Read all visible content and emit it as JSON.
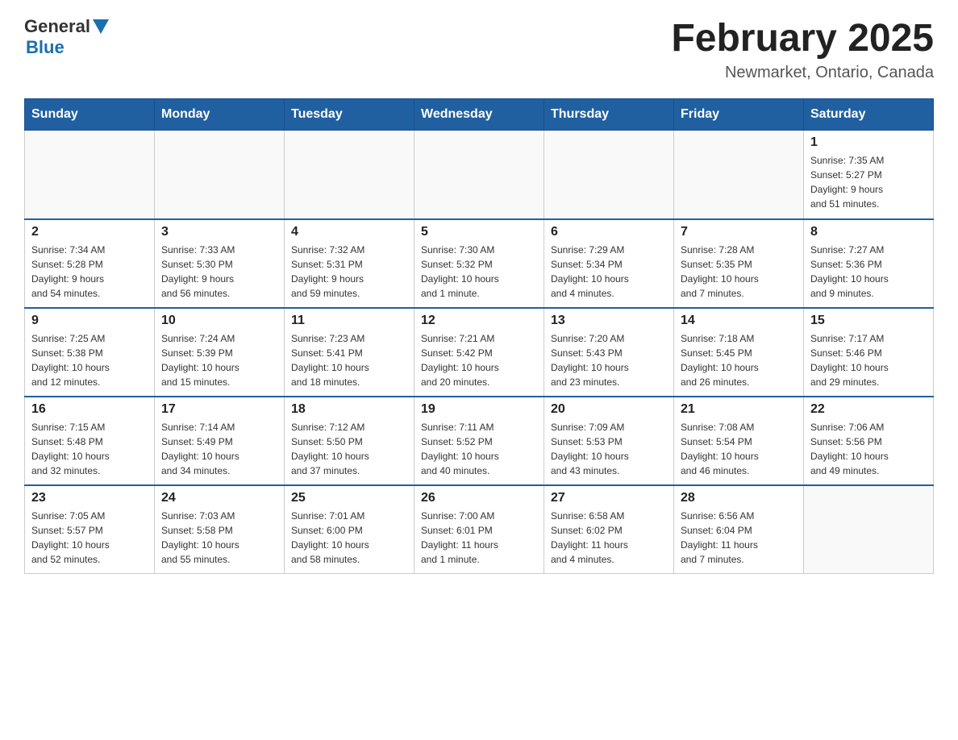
{
  "header": {
    "logo_general": "General",
    "logo_blue": "Blue",
    "month_title": "February 2025",
    "location": "Newmarket, Ontario, Canada"
  },
  "days_of_week": [
    "Sunday",
    "Monday",
    "Tuesday",
    "Wednesday",
    "Thursday",
    "Friday",
    "Saturday"
  ],
  "weeks": [
    [
      {
        "day": "",
        "info": ""
      },
      {
        "day": "",
        "info": ""
      },
      {
        "day": "",
        "info": ""
      },
      {
        "day": "",
        "info": ""
      },
      {
        "day": "",
        "info": ""
      },
      {
        "day": "",
        "info": ""
      },
      {
        "day": "1",
        "info": "Sunrise: 7:35 AM\nSunset: 5:27 PM\nDaylight: 9 hours\nand 51 minutes."
      }
    ],
    [
      {
        "day": "2",
        "info": "Sunrise: 7:34 AM\nSunset: 5:28 PM\nDaylight: 9 hours\nand 54 minutes."
      },
      {
        "day": "3",
        "info": "Sunrise: 7:33 AM\nSunset: 5:30 PM\nDaylight: 9 hours\nand 56 minutes."
      },
      {
        "day": "4",
        "info": "Sunrise: 7:32 AM\nSunset: 5:31 PM\nDaylight: 9 hours\nand 59 minutes."
      },
      {
        "day": "5",
        "info": "Sunrise: 7:30 AM\nSunset: 5:32 PM\nDaylight: 10 hours\nand 1 minute."
      },
      {
        "day": "6",
        "info": "Sunrise: 7:29 AM\nSunset: 5:34 PM\nDaylight: 10 hours\nand 4 minutes."
      },
      {
        "day": "7",
        "info": "Sunrise: 7:28 AM\nSunset: 5:35 PM\nDaylight: 10 hours\nand 7 minutes."
      },
      {
        "day": "8",
        "info": "Sunrise: 7:27 AM\nSunset: 5:36 PM\nDaylight: 10 hours\nand 9 minutes."
      }
    ],
    [
      {
        "day": "9",
        "info": "Sunrise: 7:25 AM\nSunset: 5:38 PM\nDaylight: 10 hours\nand 12 minutes."
      },
      {
        "day": "10",
        "info": "Sunrise: 7:24 AM\nSunset: 5:39 PM\nDaylight: 10 hours\nand 15 minutes."
      },
      {
        "day": "11",
        "info": "Sunrise: 7:23 AM\nSunset: 5:41 PM\nDaylight: 10 hours\nand 18 minutes."
      },
      {
        "day": "12",
        "info": "Sunrise: 7:21 AM\nSunset: 5:42 PM\nDaylight: 10 hours\nand 20 minutes."
      },
      {
        "day": "13",
        "info": "Sunrise: 7:20 AM\nSunset: 5:43 PM\nDaylight: 10 hours\nand 23 minutes."
      },
      {
        "day": "14",
        "info": "Sunrise: 7:18 AM\nSunset: 5:45 PM\nDaylight: 10 hours\nand 26 minutes."
      },
      {
        "day": "15",
        "info": "Sunrise: 7:17 AM\nSunset: 5:46 PM\nDaylight: 10 hours\nand 29 minutes."
      }
    ],
    [
      {
        "day": "16",
        "info": "Sunrise: 7:15 AM\nSunset: 5:48 PM\nDaylight: 10 hours\nand 32 minutes."
      },
      {
        "day": "17",
        "info": "Sunrise: 7:14 AM\nSunset: 5:49 PM\nDaylight: 10 hours\nand 34 minutes."
      },
      {
        "day": "18",
        "info": "Sunrise: 7:12 AM\nSunset: 5:50 PM\nDaylight: 10 hours\nand 37 minutes."
      },
      {
        "day": "19",
        "info": "Sunrise: 7:11 AM\nSunset: 5:52 PM\nDaylight: 10 hours\nand 40 minutes."
      },
      {
        "day": "20",
        "info": "Sunrise: 7:09 AM\nSunset: 5:53 PM\nDaylight: 10 hours\nand 43 minutes."
      },
      {
        "day": "21",
        "info": "Sunrise: 7:08 AM\nSunset: 5:54 PM\nDaylight: 10 hours\nand 46 minutes."
      },
      {
        "day": "22",
        "info": "Sunrise: 7:06 AM\nSunset: 5:56 PM\nDaylight: 10 hours\nand 49 minutes."
      }
    ],
    [
      {
        "day": "23",
        "info": "Sunrise: 7:05 AM\nSunset: 5:57 PM\nDaylight: 10 hours\nand 52 minutes."
      },
      {
        "day": "24",
        "info": "Sunrise: 7:03 AM\nSunset: 5:58 PM\nDaylight: 10 hours\nand 55 minutes."
      },
      {
        "day": "25",
        "info": "Sunrise: 7:01 AM\nSunset: 6:00 PM\nDaylight: 10 hours\nand 58 minutes."
      },
      {
        "day": "26",
        "info": "Sunrise: 7:00 AM\nSunset: 6:01 PM\nDaylight: 11 hours\nand 1 minute."
      },
      {
        "day": "27",
        "info": "Sunrise: 6:58 AM\nSunset: 6:02 PM\nDaylight: 11 hours\nand 4 minutes."
      },
      {
        "day": "28",
        "info": "Sunrise: 6:56 AM\nSunset: 6:04 PM\nDaylight: 11 hours\nand 7 minutes."
      },
      {
        "day": "",
        "info": ""
      }
    ]
  ]
}
